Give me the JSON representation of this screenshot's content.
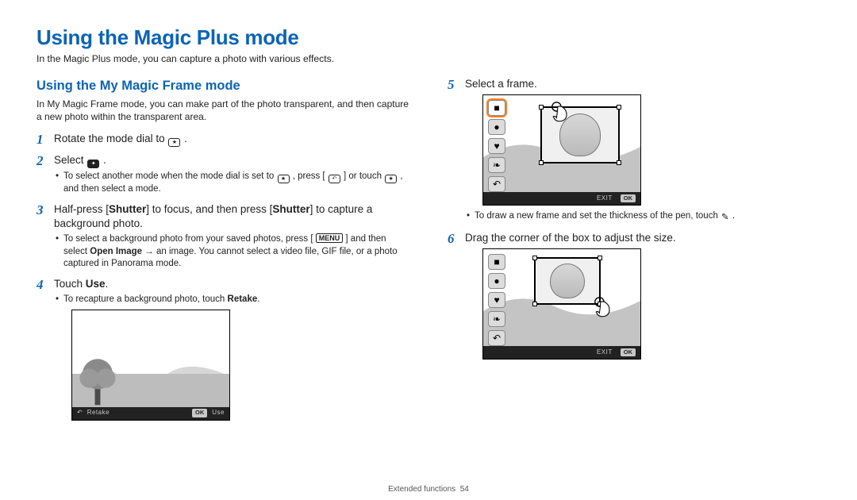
{
  "title": "Using the Magic Plus mode",
  "intro": "In the Magic Plus mode, you can capture a photo with various effects.",
  "subheading": "Using the My Magic Frame mode",
  "subintro": "In My Magic Frame mode, you can make part of the photo transparent, and then capture a new photo within the transparent area.",
  "steps_left": {
    "s1_pre": "Rotate the mode dial to ",
    "s1_post": " .",
    "s2_pre": "Select ",
    "s2_post": " .",
    "s2_bul_a1": "To select another mode when the mode dial is set to ",
    "s2_bul_a2": ", press [",
    "s2_bul_a3": "] or touch ",
    "s2_bul_a4": ", and then select a mode.",
    "s3_a": "Half-press [",
    "s3_b": "Shutter",
    "s3_c": "] to focus, and then press [",
    "s3_d": "Shutter",
    "s3_e": "] to capture a background photo.",
    "s3_bul_a1": "To select a background photo from your saved photos, press [",
    "s3_bul_a2": "] and then select ",
    "s3_bul_open": "Open Image",
    "s3_bul_a3": " → an image. You cannot select a video file, GIF file, or a photo captured in Panorama mode.",
    "s4_a": "Touch ",
    "s4_use": "Use",
    "s4_post": ".",
    "s4_bul": "To recapture a background photo, touch ",
    "s4_retake": "Retake",
    "s4_bul_post": "."
  },
  "steps_right": {
    "s5": "Select a frame.",
    "s5_bul_a": "To draw a new frame and set the thickness of the pen, touch ",
    "s5_bul_b": ".",
    "s6": "Drag the corner of the box to adjust the size."
  },
  "nums": {
    "n1": "1",
    "n2": "2",
    "n3": "3",
    "n4": "4",
    "n5": "5",
    "n6": "6"
  },
  "screen4": {
    "retake": "Retake",
    "ok": "OK",
    "use": "Use"
  },
  "screen5": {
    "exit": "EXIT",
    "ok": "OK"
  },
  "screen6": {
    "exit": "EXIT",
    "ok": "OK"
  },
  "footer_section": "Extended functions",
  "footer_page": "54",
  "icons": {
    "mode_dial": "mode-dial-magic-plus-icon",
    "sparkle": "sparkle-mode-icon",
    "back": "back-icon",
    "menu": "MENU",
    "pen": "pen-icon"
  },
  "side_icons": [
    "square-shape-icon",
    "circle-shape-icon",
    "heart-shape-icon",
    "leaves-shape-icon",
    "undo-icon"
  ]
}
